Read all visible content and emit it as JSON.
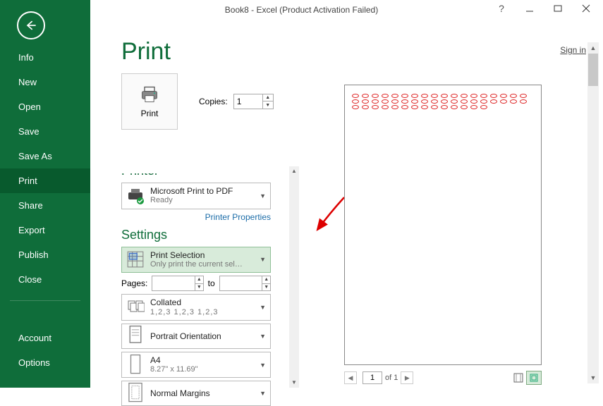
{
  "title": "Book8 - Excel (Product Activation Failed)",
  "signin": "Sign in",
  "sidebar": {
    "items": [
      "Info",
      "New",
      "Open",
      "Save",
      "Save As",
      "Print",
      "Share",
      "Export",
      "Publish",
      "Close"
    ],
    "bottom": [
      "Account",
      "Options"
    ],
    "active_index": 5
  },
  "heading": "Print",
  "print": {
    "button_label": "Print",
    "copies_label": "Copies:",
    "copies_value": "1"
  },
  "printer_section": {
    "title": "Printer",
    "selected_name": "Microsoft Print to PDF",
    "status": "Ready",
    "properties_link": "Printer Properties"
  },
  "settings": {
    "title": "Settings",
    "print_area": {
      "title": "Print Selection",
      "sub": "Only print the current sel…"
    },
    "pages_label": "Pages:",
    "pages_from": "",
    "to_label": "to",
    "pages_to": "",
    "collated": {
      "title": "Collated",
      "sub": "1,2,3   1,2,3   1,2,3"
    },
    "orientation": {
      "title": "Portrait Orientation"
    },
    "paper": {
      "title": "A4",
      "sub": "8.27\" x 11.69\""
    },
    "margins": {
      "title": "Normal Margins"
    }
  },
  "preview_nav": {
    "current_page": "1",
    "of_label": "of 1"
  }
}
